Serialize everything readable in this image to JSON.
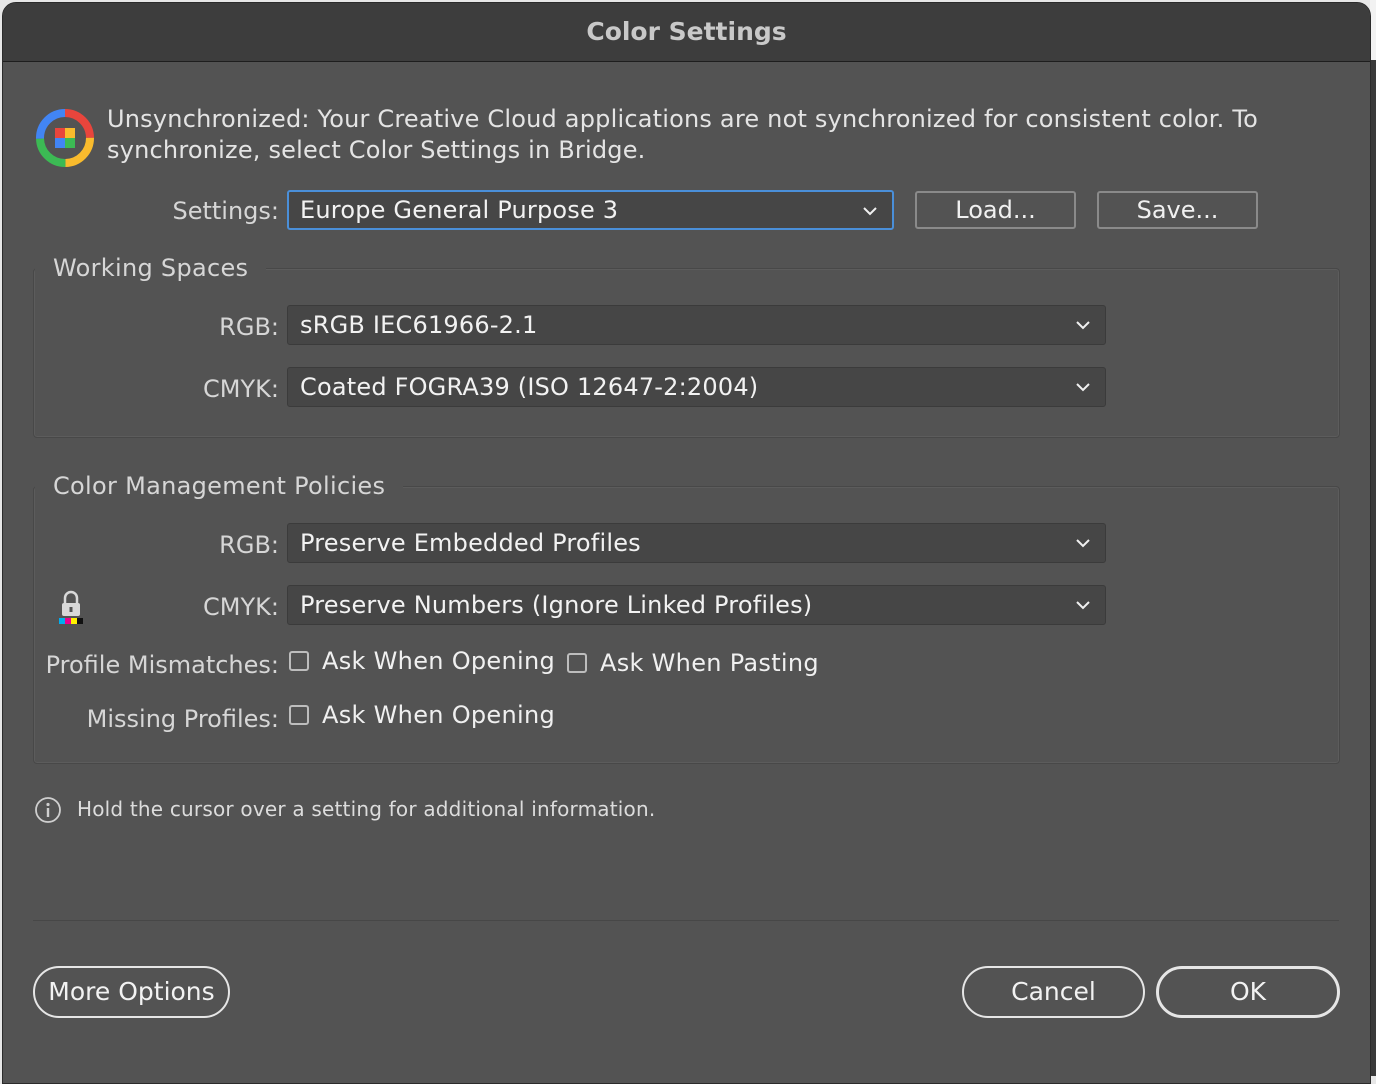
{
  "window": {
    "title": "Color Settings"
  },
  "sync_message": "Unsynchronized: Your Creative Cloud applications are not synchronized for consistent color. To synchronize, select Color Settings in Bridge.",
  "settings": {
    "label": "Settings:",
    "value": "Europe General Purpose 3",
    "load_label": "Load...",
    "save_label": "Save..."
  },
  "working_spaces": {
    "title": "Working Spaces",
    "rgb_label": "RGB:",
    "rgb_value": "sRGB IEC61966-2.1",
    "cmyk_label": "CMYK:",
    "cmyk_value": "Coated FOGRA39 (ISO 12647-2:2004)"
  },
  "policies": {
    "title": "Color Management Policies",
    "rgb_label": "RGB:",
    "rgb_value": "Preserve Embedded Profiles",
    "cmyk_label": "CMYK:",
    "cmyk_value": "Preserve Numbers (Ignore Linked Profiles)",
    "profile_mismatches_label": "Profile Mismatches:",
    "mismatch_open_label": "Ask When Opening",
    "mismatch_open_checked": false,
    "mismatch_paste_label": "Ask When Pasting",
    "mismatch_paste_checked": false,
    "missing_profiles_label": "Missing Profiles:",
    "missing_open_label": "Ask When Opening",
    "missing_open_checked": false
  },
  "info_text": "Hold the cursor over a setting for additional information.",
  "footer": {
    "more_options_label": "More Options",
    "cancel_label": "Cancel",
    "ok_label": "OK"
  },
  "colors": {
    "dialog_bg": "#535353",
    "titlebar_bg": "#3d3d3d",
    "focus_accent": "#4a8fd9"
  }
}
